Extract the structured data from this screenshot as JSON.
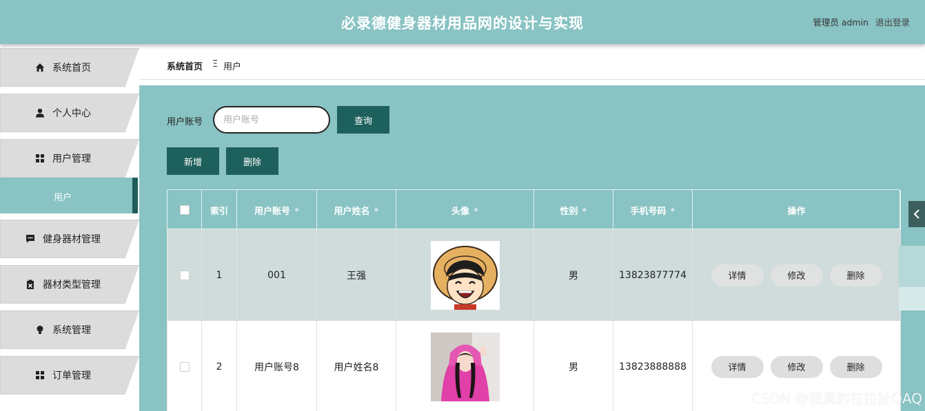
{
  "header": {
    "title": "必录德健身器材用品网的设计与实现",
    "role_label": "管理员 admin",
    "logout_label": "退出登录"
  },
  "sidebar": {
    "items": [
      {
        "label": "系统首页",
        "icon": "home-icon"
      },
      {
        "label": "个人中心",
        "icon": "user-icon"
      },
      {
        "label": "用户管理",
        "icon": "grid-icon"
      },
      {
        "label": "健身器材管理",
        "icon": "chat-icon"
      },
      {
        "label": "器材类型管理",
        "icon": "clipboard-icon"
      },
      {
        "label": "系统管理",
        "icon": "bulb-icon"
      },
      {
        "label": "订单管理",
        "icon": "grid-icon"
      }
    ],
    "active_sub_item": "用户"
  },
  "breadcrumb": {
    "home": "系统首页",
    "separator": "Ξ",
    "current": "用户"
  },
  "search": {
    "label": "用户账号",
    "placeholder": "用户账号",
    "query_button": "查询"
  },
  "actions": {
    "add_button": "新增",
    "delete_button": "删除"
  },
  "table": {
    "columns": [
      "索引",
      "用户账号",
      "用户姓名",
      "头像",
      "性别",
      "手机号码",
      "操作"
    ],
    "rows": [
      {
        "index": "1",
        "account": "001",
        "name": "王强",
        "gender": "男",
        "phone": "13823877774",
        "avatar": "cartoon-avatar"
      },
      {
        "index": "2",
        "account": "用户账号8",
        "name": "用户姓名8",
        "gender": "男",
        "phone": "13823888888",
        "avatar": "photo-avatar"
      }
    ],
    "row_actions": [
      "详情",
      "修改",
      "删除"
    ]
  },
  "watermark": "CSDN @我真的在拉扯QAQ"
}
